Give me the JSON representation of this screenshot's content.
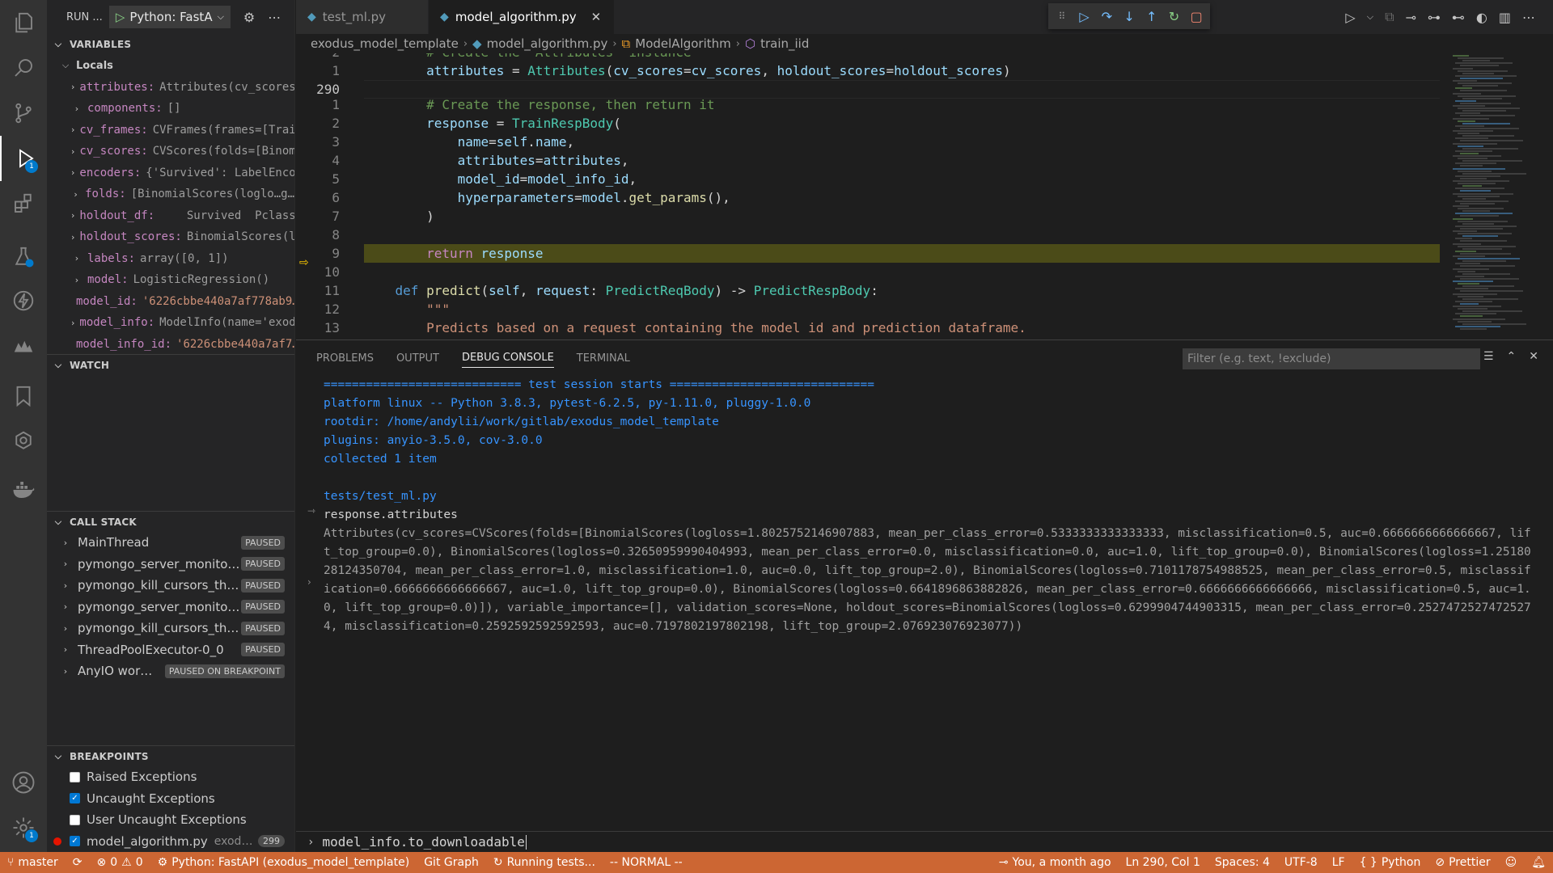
{
  "sidebar": {
    "run_label": "RUN ...",
    "run_config": "Python: FastA",
    "variables_header": "VARIABLES",
    "locals_header": "Locals",
    "variables": [
      {
        "name": "attributes:",
        "value": "Attributes(cv_scores…",
        "expandable": true
      },
      {
        "name": "components:",
        "value": "[]",
        "expandable": true
      },
      {
        "name": "cv_frames:",
        "value": "CVFrames(frames=[Trai…",
        "expandable": true
      },
      {
        "name": "cv_scores:",
        "value": "CVScores(folds=[Binom…",
        "expandable": true
      },
      {
        "name": "encoders:",
        "value": "{'Survived': LabelEnco…",
        "expandable": true
      },
      {
        "name": "folds:",
        "value": "[BinomialScores(loglo…g…",
        "expandable": true
      },
      {
        "name": "holdout_df:",
        "value": "    Survived  Pclass…",
        "expandable": true
      },
      {
        "name": "holdout_scores:",
        "value": "BinomialScores(l…",
        "expandable": true
      },
      {
        "name": "labels:",
        "value": "array([0, 1])",
        "expandable": true
      },
      {
        "name": "model:",
        "value": "LogisticRegression()",
        "expandable": true
      },
      {
        "name": "model_id:",
        "value": "'6226cbbe440a7af778ab9…",
        "expandable": false
      },
      {
        "name": "model_info:",
        "value": "ModelInfo(name='exod…",
        "expandable": true
      },
      {
        "name": "model_info_id:",
        "value": "'6226cbbe440a7af7…",
        "expandable": false
      }
    ],
    "watch_header": "WATCH",
    "callstack_header": "CALL STACK",
    "callstack": [
      {
        "name": "MainThread",
        "state": "PAUSED"
      },
      {
        "name": "pymongo_server_monito…",
        "state": "PAUSED"
      },
      {
        "name": "pymongo_kill_cursors_th…",
        "state": "PAUSED"
      },
      {
        "name": "pymongo_server_monito…",
        "state": "PAUSED"
      },
      {
        "name": "pymongo_kill_cursors_th…",
        "state": "PAUSED"
      },
      {
        "name": "ThreadPoolExecutor-0_0",
        "state": "PAUSED"
      },
      {
        "name": "AnyIO wor…",
        "state": "PAUSED ON BREAKPOINT"
      }
    ],
    "breakpoints_header": "BREAKPOINTS",
    "breakpoints": [
      {
        "label": "Raised Exceptions",
        "checked": false
      },
      {
        "label": "Uncaught Exceptions",
        "checked": true
      },
      {
        "label": "User Uncaught Exceptions",
        "checked": false
      }
    ],
    "breakpoint_file": {
      "file": "model_algorithm.py",
      "dir": "exod…",
      "line": "299"
    }
  },
  "activity": {
    "debug_badge": "1",
    "settings_badge": "1"
  },
  "tabs": [
    {
      "label": "test_ml.py",
      "active": false
    },
    {
      "label": "model_algorithm.py",
      "active": true
    }
  ],
  "breadcrumb": [
    "exodus_model_template",
    "model_algorithm.py",
    "ModelAlgorithm",
    "train_iid"
  ],
  "editor": {
    "lines": [
      {
        "num": "2",
        "text": "        # Create the `Attributes` instance",
        "type": "comment"
      },
      {
        "num": "1",
        "text": "        attributes = Attributes(cv_scores=cv_scores, holdout_scores=holdout_scores)",
        "type": "code"
      },
      {
        "num": "290",
        "text": "",
        "type": "blank",
        "current": true
      },
      {
        "num": "1",
        "text": "        # Create the response, then return it",
        "type": "comment"
      },
      {
        "num": "2",
        "text": "        response = TrainRespBody(",
        "type": "code"
      },
      {
        "num": "3",
        "text": "            name=self.name,",
        "type": "code"
      },
      {
        "num": "4",
        "text": "            attributes=attributes,",
        "type": "code"
      },
      {
        "num": "5",
        "text": "            model_id=model_info_id,",
        "type": "code"
      },
      {
        "num": "6",
        "text": "            hyperparameters=model.get_params(),",
        "type": "code"
      },
      {
        "num": "7",
        "text": "        )",
        "type": "code"
      },
      {
        "num": "8",
        "text": "",
        "type": "blank"
      },
      {
        "num": "9",
        "text": "        return response",
        "type": "highlight"
      },
      {
        "num": "10",
        "text": "",
        "type": "blank"
      },
      {
        "num": "11",
        "text": "    def predict(self, request: PredictReqBody) -> PredictRespBody:",
        "type": "code"
      },
      {
        "num": "12",
        "text": "        \"\"\"",
        "type": "string"
      },
      {
        "num": "13",
        "text": "        Predicts based on a request containing the model id and prediction dataframe.",
        "type": "string"
      }
    ]
  },
  "panel": {
    "tabs": [
      "PROBLEMS",
      "OUTPUT",
      "DEBUG CONSOLE",
      "TERMINAL"
    ],
    "active_tab": "DEBUG CONSOLE",
    "filter_placeholder": "Filter (e.g. text, !exclude)",
    "console": [
      {
        "text": "============================ test session starts =============================",
        "style": "blue"
      },
      {
        "text": "platform linux -- Python 3.8.3, pytest-6.2.5, py-1.11.0, pluggy-1.0.0",
        "style": "blue"
      },
      {
        "text": "rootdir: /home/andylii/work/gitlab/exodus_model_template",
        "style": "blue"
      },
      {
        "text": "plugins: anyio-3.5.0, cov-3.0.0",
        "style": "blue"
      },
      {
        "text": "collected 1 item",
        "style": "blue"
      },
      {
        "text": "",
        "style": "blue"
      },
      {
        "text": "tests/test_ml.py",
        "style": "blue"
      },
      {
        "text": "response.attributes",
        "style": "plain"
      },
      {
        "text": "Attributes(cv_scores=CVScores(folds=[BinomialScores(logloss=1.8025752146907883, mean_per_class_error=0.5333333333333333, misclassification=0.5, auc=0.6666666666666667, lift_top_group=0.0), BinomialScores(logloss=0.32650959990404993, mean_per_class_error=0.0, misclassification=0.0, auc=1.0, lift_top_group=0.0), BinomialScores(logloss=1.2518028124350704, mean_per_class_error=1.0, misclassification=1.0, auc=0.0, lift_top_group=2.0), BinomialScores(logloss=0.7101178754988525, mean_per_class_error=0.5, misclassification=0.6666666666666667, auc=1.0, lift_top_group=0.0), BinomialScores(logloss=0.6641896863882826, mean_per_class_error=0.6666666666666666, misclassification=0.5, auc=1.0, lift_top_group=0.0)]), variable_importance=[], validation_scores=None, holdout_scores=BinomialScores(logloss=0.6299904744903315, mean_per_class_error=0.25274725274725274, misclassification=0.2592592592592593, auc=0.7197802197802198, lift_top_group=2.076923076923077))",
        "style": "grey"
      }
    ],
    "repl_input": "model_info.to_downloadable"
  },
  "statusbar": {
    "branch": "master",
    "errors": "0",
    "warnings": "0",
    "debug_config": "Python: FastAPI (exodus_model_template)",
    "git_graph": "Git Graph",
    "running": "Running tests...",
    "mode": "-- NORMAL --",
    "blame": "You, a month ago",
    "position": "Ln 290, Col 1",
    "spaces": "Spaces: 4",
    "encoding": "UTF-8",
    "eol": "LF",
    "language": "Python",
    "prettier": "Prettier"
  },
  "colors": {
    "statusbar": "#cc6633",
    "accent": "#007acc",
    "highlight_line": "#4b4b18"
  }
}
